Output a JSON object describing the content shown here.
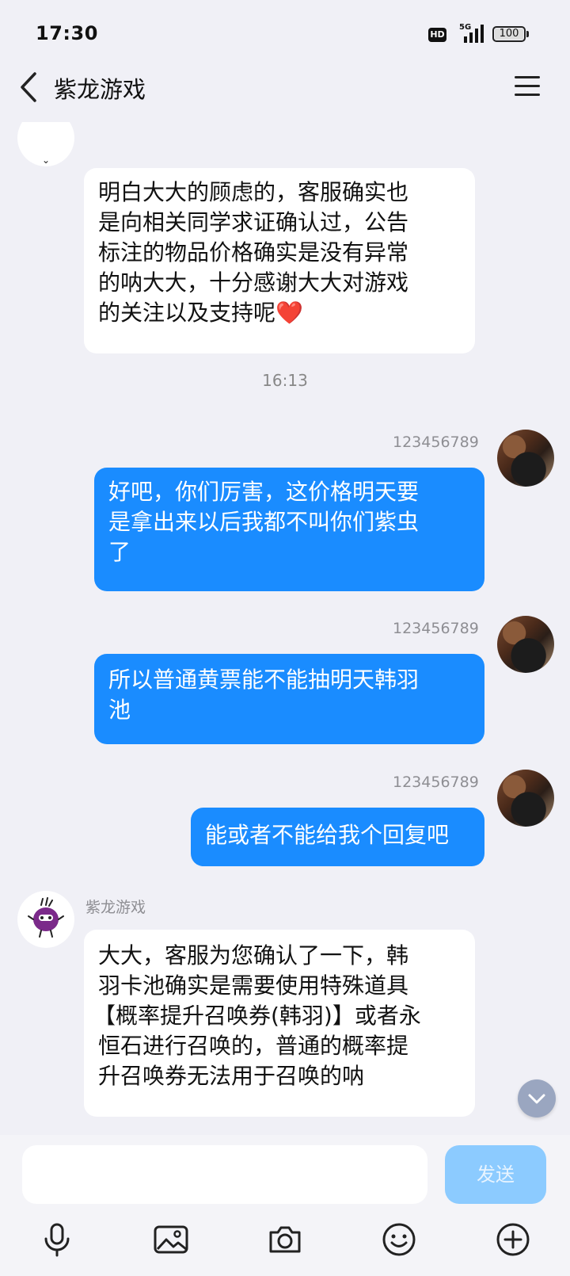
{
  "status_bar": {
    "time": "17:30",
    "hd_badge": "HD",
    "network": "5G",
    "battery": "100"
  },
  "header": {
    "title": "紫龙游戏",
    "back_icon": "chevron-left-icon",
    "menu_icon": "hamburger-menu-icon"
  },
  "messages": [
    {
      "direction": "incoming",
      "lines": [
        "明白大大的顾虑的，客服确实也",
        "是向相关同学求证确认过，公告",
        "标注的物品价格确实是没有异常",
        "的呐大大，十分感谢大大对游戏",
        "的关注以及支持呢"
      ],
      "emoji": "❤️"
    },
    {
      "direction": "outgoing",
      "sender": "123456789",
      "lines": [
        "好吧，你们厉害，这价格明天要",
        "是拿出来以后我都不叫你们紫虫",
        "了"
      ]
    },
    {
      "direction": "outgoing",
      "sender": "123456789",
      "lines": [
        "所以普通黄票能不能抽明天韩羽",
        "池"
      ]
    },
    {
      "direction": "outgoing",
      "sender": "123456789",
      "lines": [
        "能或者不能给我个回复吧"
      ]
    },
    {
      "direction": "incoming",
      "sender": "紫龙游戏",
      "lines": [
        "大大，客服为您确认了一下，韩",
        "羽卡池确实是需要使用特殊道具",
        "【概率提升召唤券(韩羽)】或者永",
        "恒石进行召唤的，普通的概率提",
        "升召唤券无法用于召唤的呐"
      ]
    }
  ],
  "timestamp": "16:13",
  "composer": {
    "input_value": "",
    "send_label": "发送"
  },
  "toolbar": {
    "items": [
      "microphone-icon",
      "image-icon",
      "camera-icon",
      "emoji-icon",
      "plus-icon"
    ]
  },
  "colors": {
    "outgoing_bubble": "#1a8cff",
    "incoming_bubble": "#ffffff",
    "background": "#f0f0f6",
    "send_button": "#8ccbff"
  }
}
